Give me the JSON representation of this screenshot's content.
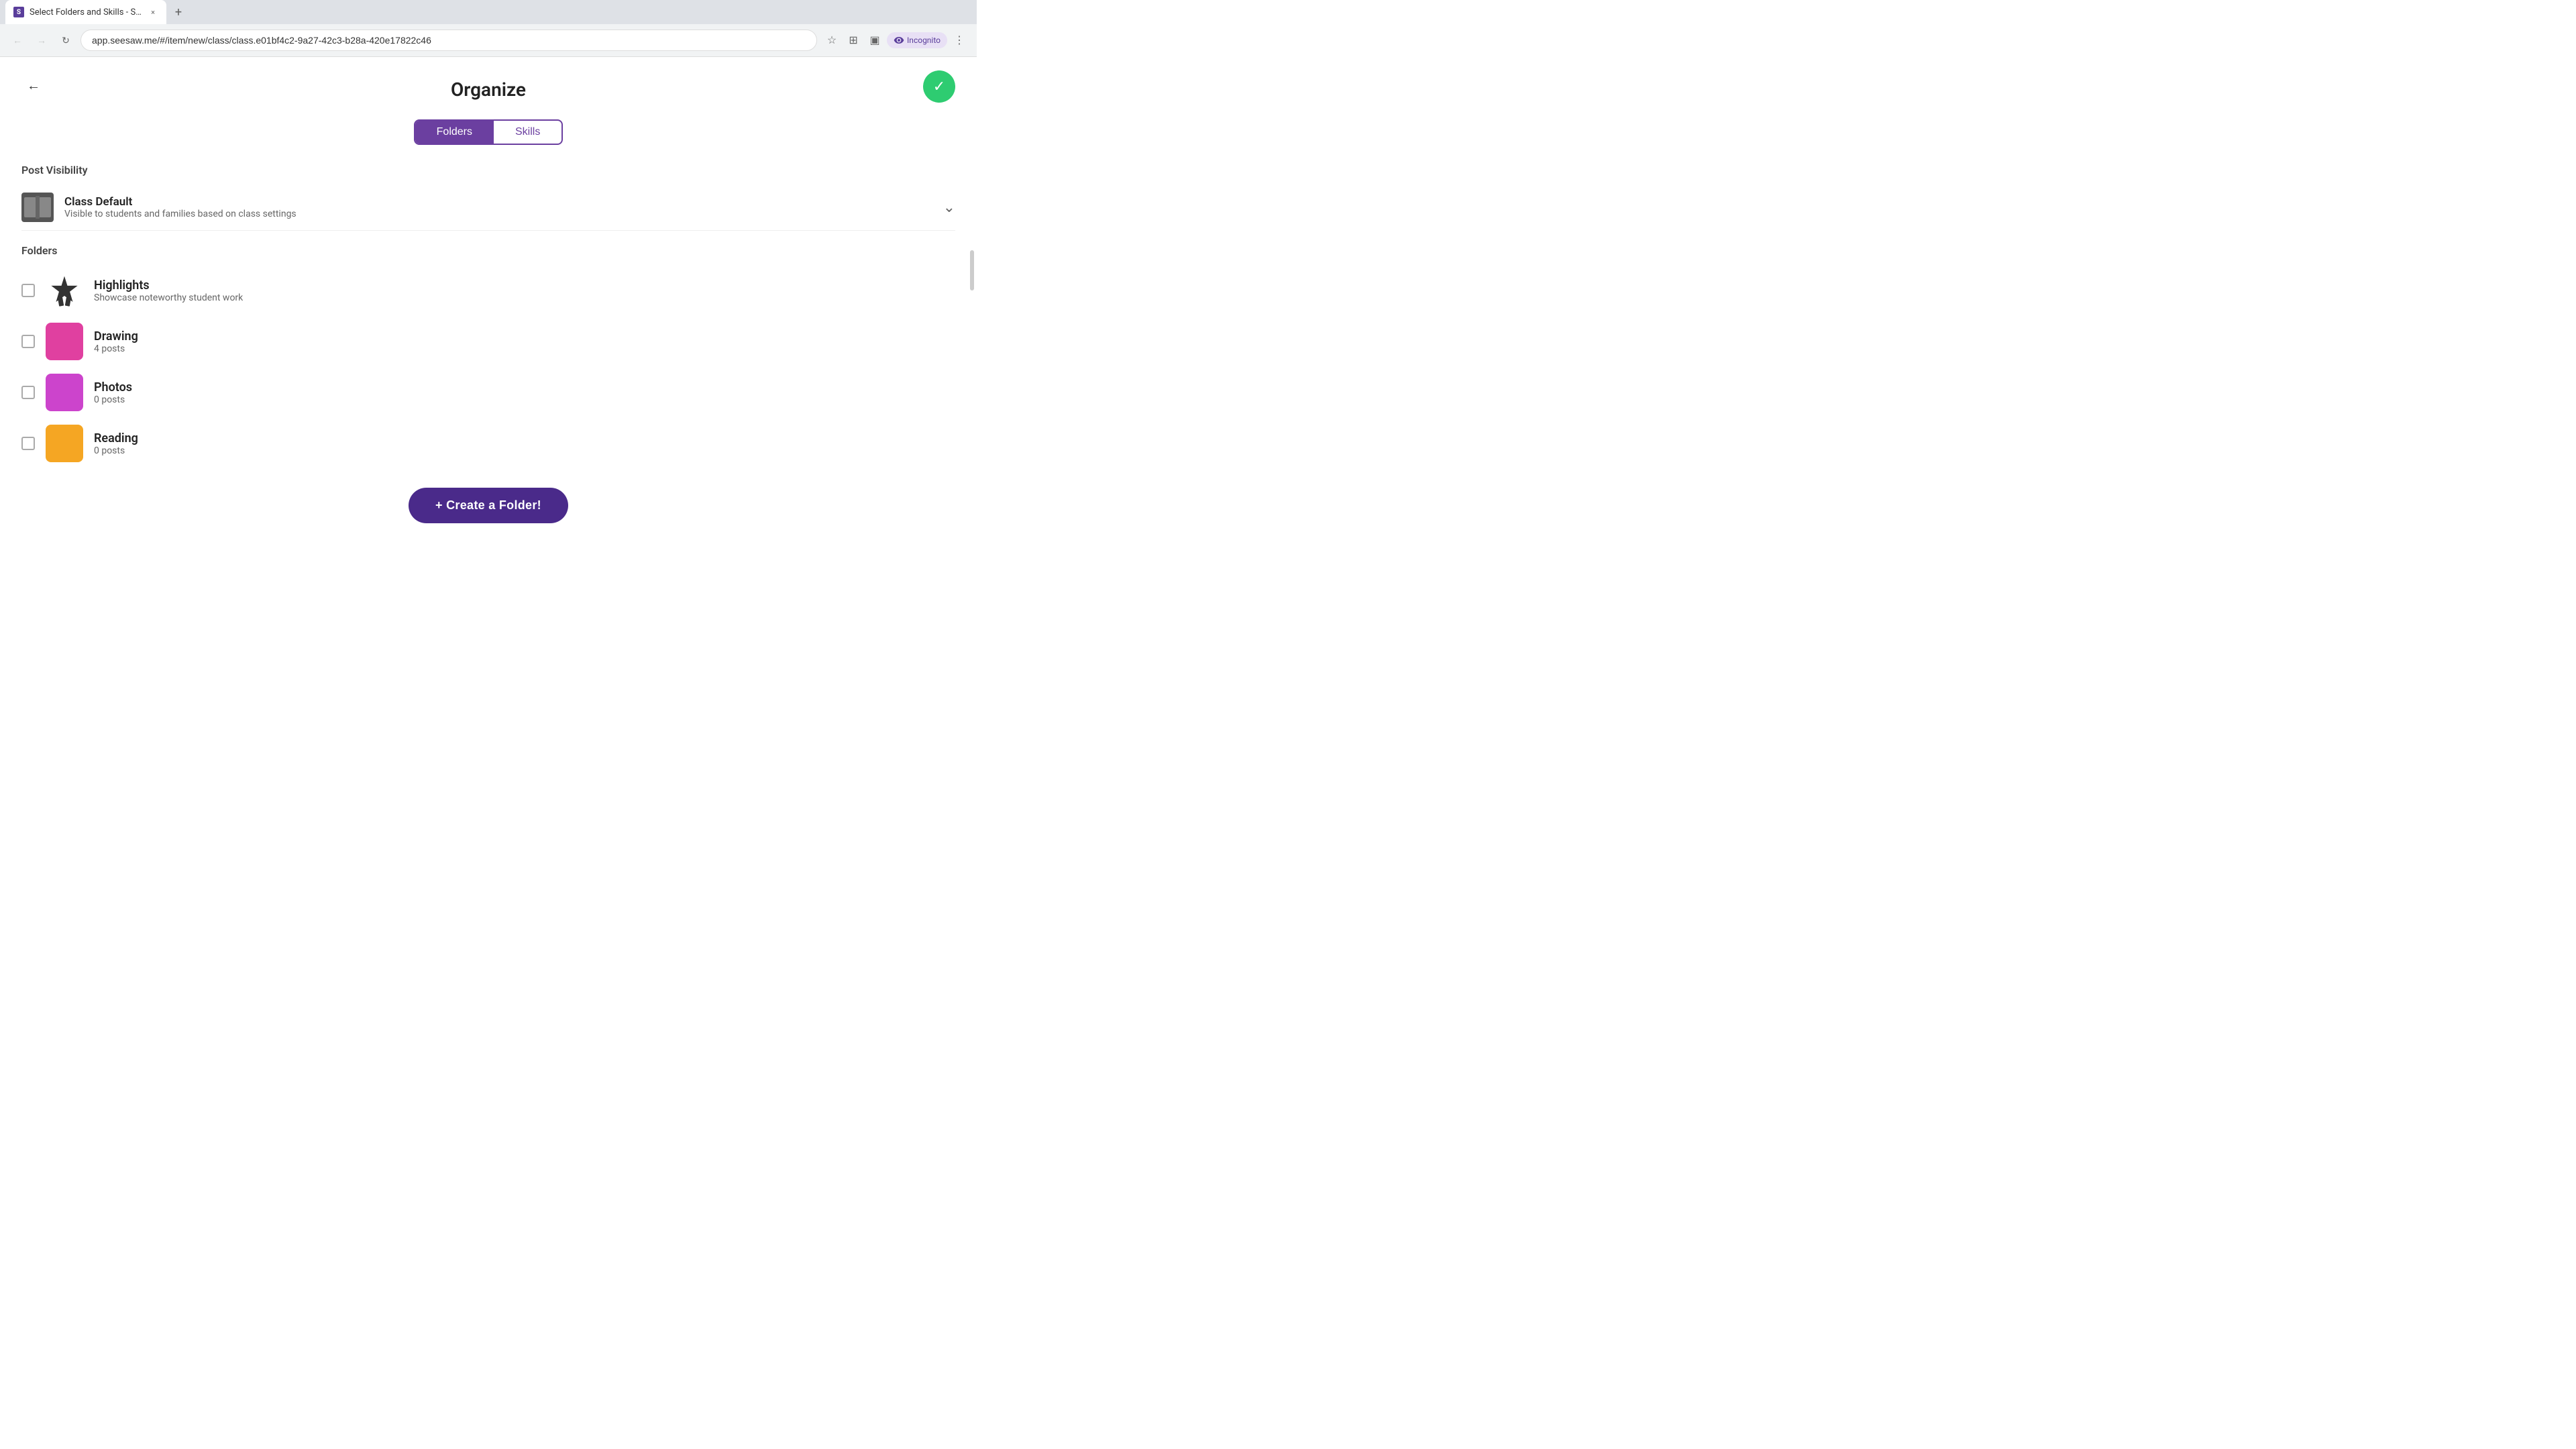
{
  "browser": {
    "tab": {
      "favicon_text": "S",
      "title": "Select Folders and Skills - Sees...",
      "close_icon": "×",
      "new_tab_icon": "+"
    },
    "nav": {
      "back_disabled": true,
      "forward_disabled": true,
      "reload_icon": "↻",
      "url": "app.seesaw.me/#/item/new/class/class.e01bf4c2-9a27-42c3-b28a-420e17822c46"
    },
    "toolbar": {
      "bookmark_icon": "☆",
      "extensions_icon": "⊞",
      "layout_icon": "▣",
      "incognito_label": "Incognito",
      "menu_icon": "⋮"
    }
  },
  "page": {
    "back_icon": "←",
    "title": "Organize",
    "confirm_icon": "✓",
    "tabs": [
      {
        "id": "folders",
        "label": "Folders",
        "active": true
      },
      {
        "id": "skills",
        "label": "Skills",
        "active": false
      }
    ],
    "post_visibility": {
      "section_label": "Post Visibility",
      "title": "Class Default",
      "description": "Visible to students and families based on class settings",
      "chevron": "⌄"
    },
    "folders": {
      "section_label": "Folders",
      "items": [
        {
          "id": "highlights",
          "name": "Highlights",
          "description": "Showcase noteworthy student work",
          "type": "highlights",
          "checked": false
        },
        {
          "id": "drawing",
          "name": "Drawing",
          "description": "4 posts",
          "color": "#e040a0",
          "checked": false
        },
        {
          "id": "photos",
          "name": "Photos",
          "description": "0 posts",
          "color": "#cc44cc",
          "checked": false
        },
        {
          "id": "reading",
          "name": "Reading",
          "description": "0 posts",
          "color": "#f5a623",
          "checked": false
        }
      ]
    },
    "create_folder_button": "+ Create a Folder!"
  }
}
